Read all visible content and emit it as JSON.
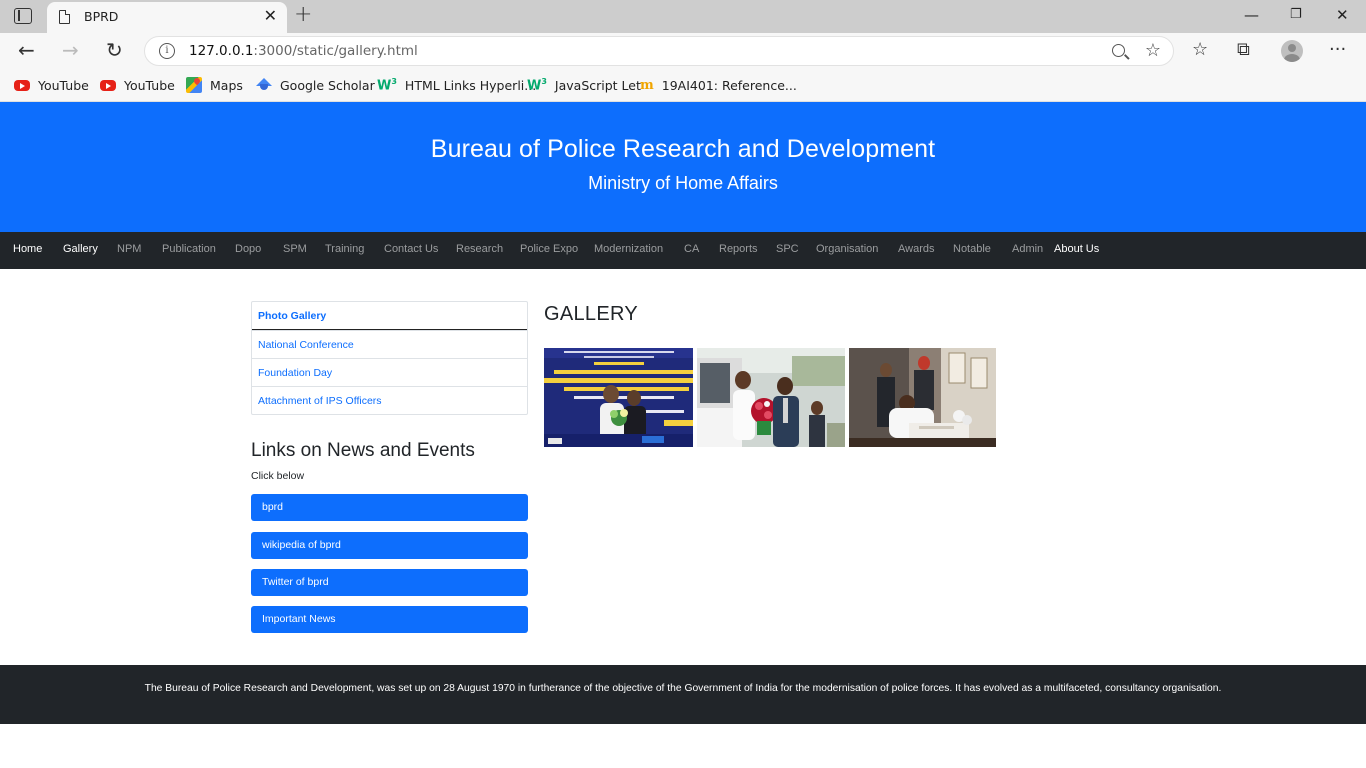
{
  "browser": {
    "tab_title": "BPRD",
    "url_host": "127.0.0.1",
    "url_rest": ":3000/static/gallery.html",
    "bookmarks": [
      {
        "label": "YouTube",
        "icon": "youtube-icon"
      },
      {
        "label": "YouTube",
        "icon": "youtube-icon"
      },
      {
        "label": "Maps",
        "icon": "maps-icon"
      },
      {
        "label": "Google Scholar",
        "icon": "google-scholar-icon"
      },
      {
        "label": "HTML Links Hyperli...",
        "icon": "w3schools-icon"
      },
      {
        "label": "JavaScript Let",
        "icon": "w3schools-icon"
      },
      {
        "label": "19AI401: Reference...",
        "icon": "moodle-icon"
      }
    ]
  },
  "header": {
    "title": "Bureau of Police Research and Development",
    "subtitle": "Ministry of Home Affairs",
    "color": "#0d6efd"
  },
  "nav": {
    "items": [
      {
        "label": "Home",
        "active": true
      },
      {
        "label": "Gallery",
        "active": true
      },
      {
        "label": "NPM",
        "active": false
      },
      {
        "label": "Publication",
        "active": false
      },
      {
        "label": "Dopo",
        "active": false
      },
      {
        "label": "SPM",
        "active": false
      },
      {
        "label": "Training",
        "active": false
      },
      {
        "label": "Contact Us",
        "active": false
      },
      {
        "label": "Research",
        "active": false
      },
      {
        "label": "Police Expo",
        "active": false
      },
      {
        "label": "Modernization",
        "active": false
      },
      {
        "label": "CA",
        "active": false
      },
      {
        "label": "Reports",
        "active": false
      },
      {
        "label": "SPC",
        "active": false
      },
      {
        "label": "Organisation",
        "active": false
      },
      {
        "label": "Awards",
        "active": false
      },
      {
        "label": "Notable",
        "active": false
      },
      {
        "label": "Admin",
        "active": false
      },
      {
        "label": "About Us",
        "active": true
      }
    ]
  },
  "sidebar": {
    "items": [
      "Photo Gallery",
      "National Conference",
      "Foundation Day",
      "Attachment of IPS Officers"
    ]
  },
  "links": {
    "title": "Links on News and Events",
    "subtitle": "Click below",
    "buttons": [
      "bprd",
      "wikipedia of bprd",
      "Twitter of bprd",
      "Important News"
    ]
  },
  "gallery": {
    "title": "GALLERY",
    "photos": [
      "conference-photo",
      "bouquet-photo",
      "signing-photo"
    ]
  },
  "footer": {
    "text": "The Bureau of Police Research and Development, was set up on 28 August 1970 in furtherance of the objective of the Government of India for the modernisation of police forces. It has evolved as a multifaceted, consultancy organisation."
  }
}
